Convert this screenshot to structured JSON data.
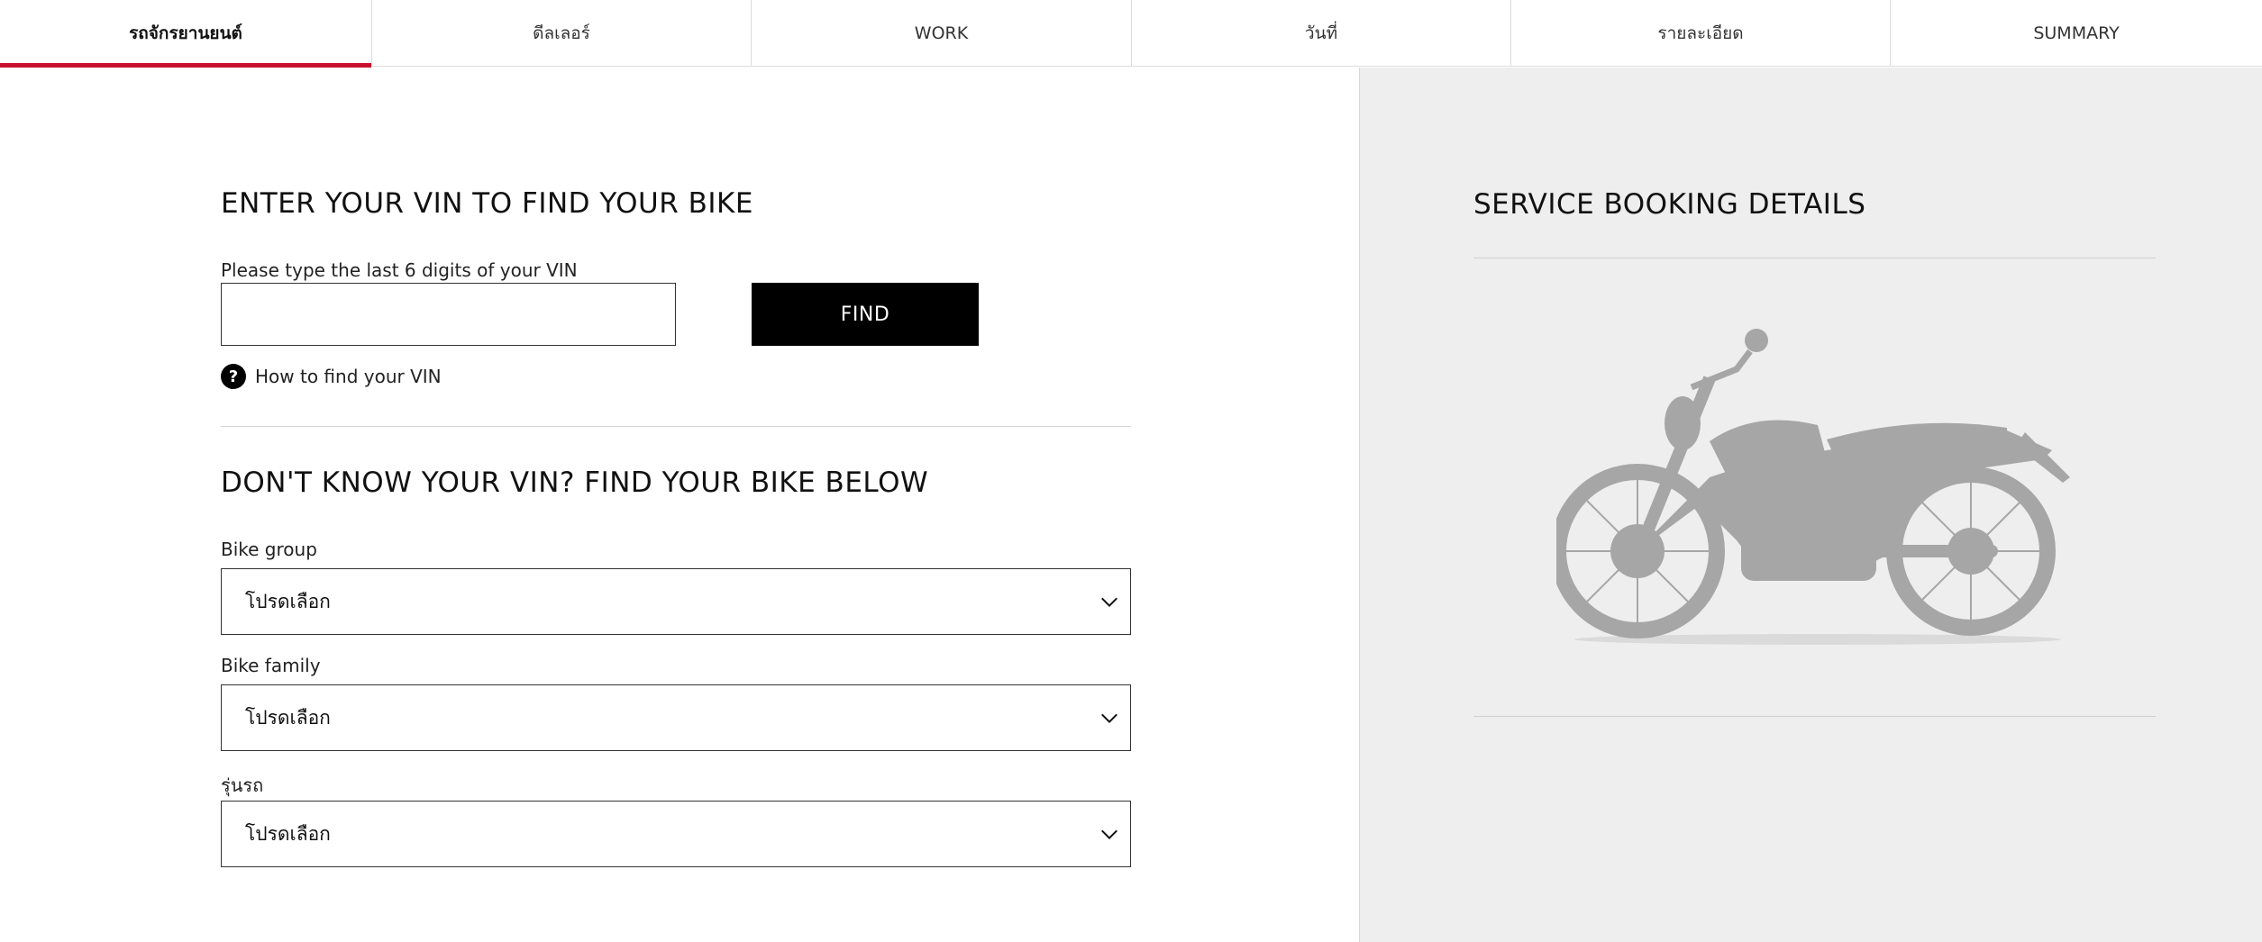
{
  "tabs": [
    {
      "label": "รถจักรยานยนต์",
      "active": true
    },
    {
      "label": "ดีลเลอร์",
      "active": false
    },
    {
      "label": "WORK",
      "active": false
    },
    {
      "label": "วันที่",
      "active": false
    },
    {
      "label": "รายละเอียด",
      "active": false
    },
    {
      "label": "SUMMARY",
      "active": false
    }
  ],
  "vin_section": {
    "title": "ENTER YOUR VIN TO FIND YOUR BIKE",
    "input_label": "Please type the last 6 digits of your VIN",
    "input_value": "",
    "find_label": "FIND",
    "help_icon": "?",
    "help_text": "How to find your VIN"
  },
  "find_bike_section": {
    "title": "DON'T KNOW YOUR VIN? FIND YOUR BIKE BELOW",
    "fields": [
      {
        "label": "Bike group",
        "value": "โปรดเลือก"
      },
      {
        "label": "Bike family",
        "value": "โปรดเลือก"
      },
      {
        "label": "รุ่นรถ",
        "value": "โปรดเลือก"
      }
    ]
  },
  "summary_panel": {
    "title": "SERVICE BOOKING DETAILS",
    "image_icon": "motorcycle-silhouette"
  },
  "colors": {
    "accent": "#c8102e",
    "button_bg": "#000000",
    "panel_bg": "#eeeeee",
    "bike_silhouette": "#a6a6a6"
  }
}
